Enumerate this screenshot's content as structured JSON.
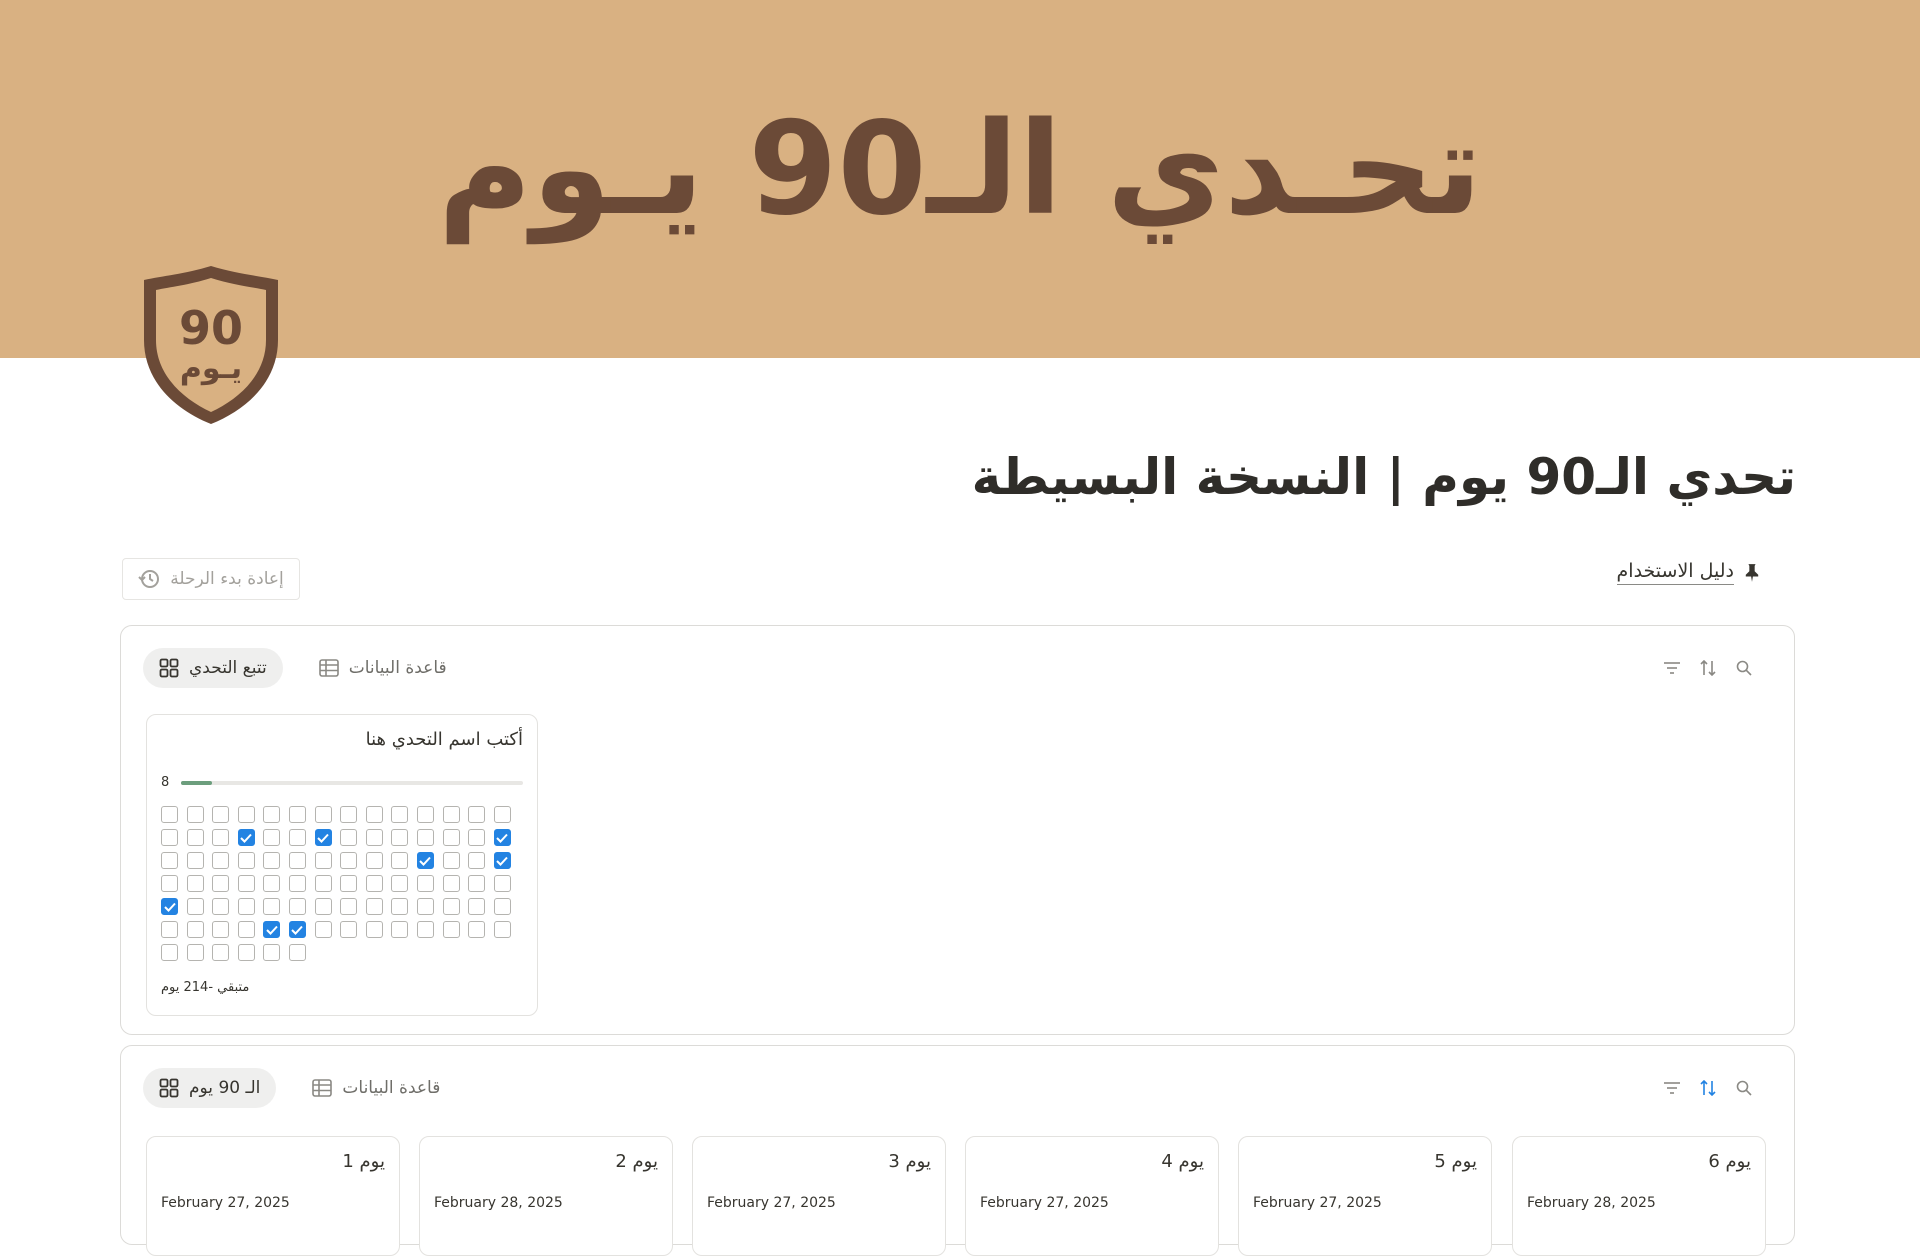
{
  "cover": {
    "text": "تحـدي الـ90 يـوم",
    "color": "#d9b182"
  },
  "icon": {
    "number": "90",
    "word": "يـوم",
    "name": "shield-90-icon"
  },
  "page": {
    "title": "تحدي الـ90 يوم | النسخة البسيطة"
  },
  "guide_link": {
    "label": "دليل الاستخدام",
    "icon": "pin-icon"
  },
  "restart_button": {
    "label": "إعادة بدء الرحلة",
    "icon": "history-icon"
  },
  "tracker_db": {
    "tabs": [
      {
        "label": "تتبع التحدي",
        "icon": "gallery-icon",
        "active": true
      },
      {
        "label": "قاعدة البيانات",
        "icon": "table-icon",
        "active": false
      }
    ],
    "card": {
      "title": "أكتب اسم التحدي هنا",
      "count": "8",
      "progress": 0.089,
      "checked_indices": [
        17,
        20,
        27,
        38,
        41,
        56,
        74,
        75
      ],
      "total_checkboxes": 90,
      "remaining": "متبقي -214 يوم"
    }
  },
  "days_db": {
    "tabs": [
      {
        "label": "الـ 90 يوم",
        "icon": "gallery-icon",
        "active": true
      },
      {
        "label": "قاعدة البيانات",
        "icon": "table-icon",
        "active": false
      }
    ],
    "days": [
      {
        "title": "يوم 1",
        "date": "February 27, 2025"
      },
      {
        "title": "يوم 2",
        "date": "February 28, 2025"
      },
      {
        "title": "يوم 3",
        "date": "February 27, 2025"
      },
      {
        "title": "يوم 4",
        "date": "February 27, 2025"
      },
      {
        "title": "يوم 5",
        "date": "February 27, 2025"
      },
      {
        "title": "يوم 6",
        "date": "February 28, 2025"
      }
    ]
  },
  "colors": {
    "accent": "#2383e2",
    "brown": "#6b4a37",
    "progress": "#6c9e7d"
  }
}
